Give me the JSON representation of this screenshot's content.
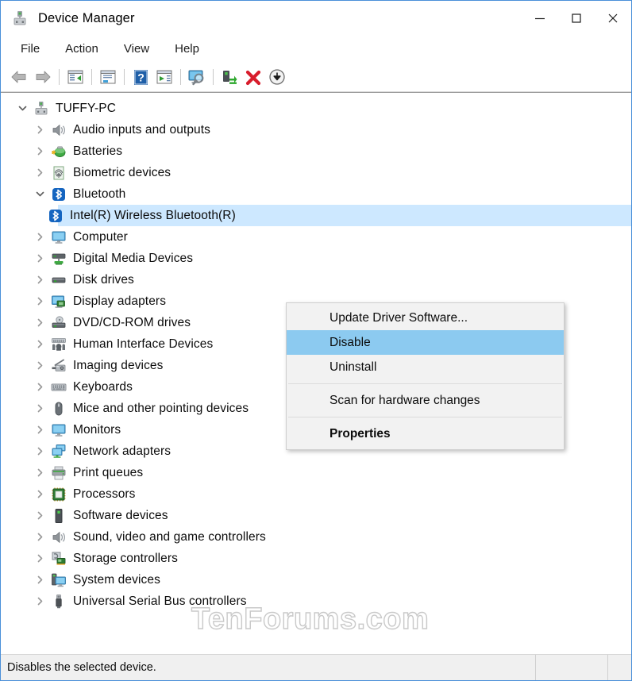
{
  "window": {
    "title": "Device Manager",
    "app_icon": "device-manager-icon",
    "accent_border": "#4a90d9",
    "caption": {
      "minimize": "minimize-button",
      "maximize": "maximize-button",
      "close": "close-button"
    }
  },
  "menubar": {
    "items": [
      {
        "label": "File"
      },
      {
        "label": "Action"
      },
      {
        "label": "View"
      },
      {
        "label": "Help"
      }
    ]
  },
  "toolbar": {
    "buttons": [
      {
        "name": "back-icon"
      },
      {
        "name": "forward-icon"
      },
      {
        "name": "separator"
      },
      {
        "name": "show-hide-console-tree-icon"
      },
      {
        "name": "separator"
      },
      {
        "name": "properties-icon"
      },
      {
        "name": "separator"
      },
      {
        "name": "help-icon"
      },
      {
        "name": "update-driver-icon"
      },
      {
        "name": "separator"
      },
      {
        "name": "scan-for-hardware-changes-icon"
      },
      {
        "name": "separator"
      },
      {
        "name": "uninstall-device-icon"
      },
      {
        "name": "disable-device-icon"
      },
      {
        "name": "enable-device-icon"
      }
    ]
  },
  "tree": {
    "nodes": [
      {
        "label": "TUFFY-PC",
        "level": 0,
        "twisty": "expanded",
        "icon": "computer-root-icon",
        "selected": false
      },
      {
        "label": "Audio inputs and outputs",
        "level": 1,
        "twisty": "collapsed",
        "icon": "speaker-icon",
        "selected": false
      },
      {
        "label": "Batteries",
        "level": 1,
        "twisty": "collapsed",
        "icon": "battery-icon",
        "selected": false
      },
      {
        "label": "Biometric devices",
        "level": 1,
        "twisty": "collapsed",
        "icon": "fingerprint-icon",
        "selected": false
      },
      {
        "label": "Bluetooth",
        "level": 1,
        "twisty": "expanded",
        "icon": "bluetooth-icon",
        "selected": false
      },
      {
        "label": "Intel(R) Wireless Bluetooth(R)",
        "level": 2,
        "twisty": "none",
        "icon": "bluetooth-icon",
        "selected": true
      },
      {
        "label": "Computer",
        "level": 1,
        "twisty": "collapsed",
        "icon": "monitor-icon",
        "selected": false
      },
      {
        "label": "Digital Media Devices",
        "level": 1,
        "twisty": "collapsed",
        "icon": "media-device-icon",
        "selected": false
      },
      {
        "label": "Disk drives",
        "level": 1,
        "twisty": "collapsed",
        "icon": "disk-drive-icon",
        "selected": false
      },
      {
        "label": "Display adapters",
        "level": 1,
        "twisty": "collapsed",
        "icon": "display-adapter-icon",
        "selected": false
      },
      {
        "label": "DVD/CD-ROM drives",
        "level": 1,
        "twisty": "collapsed",
        "icon": "dvd-drive-icon",
        "selected": false
      },
      {
        "label": "Human Interface Devices",
        "level": 1,
        "twisty": "collapsed",
        "icon": "hid-icon",
        "selected": false
      },
      {
        "label": "Imaging devices",
        "level": 1,
        "twisty": "collapsed",
        "icon": "camera-icon",
        "selected": false
      },
      {
        "label": "Keyboards",
        "level": 1,
        "twisty": "collapsed",
        "icon": "keyboard-icon",
        "selected": false
      },
      {
        "label": "Mice and other pointing devices",
        "level": 1,
        "twisty": "collapsed",
        "icon": "mouse-icon",
        "selected": false
      },
      {
        "label": "Monitors",
        "level": 1,
        "twisty": "collapsed",
        "icon": "monitor-icon",
        "selected": false
      },
      {
        "label": "Network adapters",
        "level": 1,
        "twisty": "collapsed",
        "icon": "network-adapter-icon",
        "selected": false
      },
      {
        "label": "Print queues",
        "level": 1,
        "twisty": "collapsed",
        "icon": "printer-icon",
        "selected": false
      },
      {
        "label": "Processors",
        "level": 1,
        "twisty": "collapsed",
        "icon": "processor-icon",
        "selected": false
      },
      {
        "label": "Software devices",
        "level": 1,
        "twisty": "collapsed",
        "icon": "software-device-icon",
        "selected": false
      },
      {
        "label": "Sound, video and game controllers",
        "level": 1,
        "twisty": "collapsed",
        "icon": "speaker-icon",
        "selected": false
      },
      {
        "label": "Storage controllers",
        "level": 1,
        "twisty": "collapsed",
        "icon": "storage-controller-icon",
        "selected": false
      },
      {
        "label": "System devices",
        "level": 1,
        "twisty": "collapsed",
        "icon": "system-device-icon",
        "selected": false
      },
      {
        "label": "Universal Serial Bus controllers",
        "level": 1,
        "twisty": "collapsed",
        "icon": "usb-icon",
        "selected": false
      }
    ],
    "selection_color": "#cde8ff"
  },
  "context_menu": {
    "items": [
      {
        "label": "Update Driver Software...",
        "highlight": false,
        "bold": false
      },
      {
        "label": "Disable",
        "highlight": true,
        "bold": false
      },
      {
        "label": "Uninstall",
        "highlight": false,
        "bold": false
      },
      {
        "separator": true
      },
      {
        "label": "Scan for hardware changes",
        "highlight": false,
        "bold": false
      },
      {
        "separator": true
      },
      {
        "label": "Properties",
        "highlight": false,
        "bold": true
      }
    ],
    "highlight_color": "#8ccaf0"
  },
  "watermark": {
    "text": "TenForums.com"
  },
  "statusbar": {
    "message": "Disables the selected device."
  }
}
